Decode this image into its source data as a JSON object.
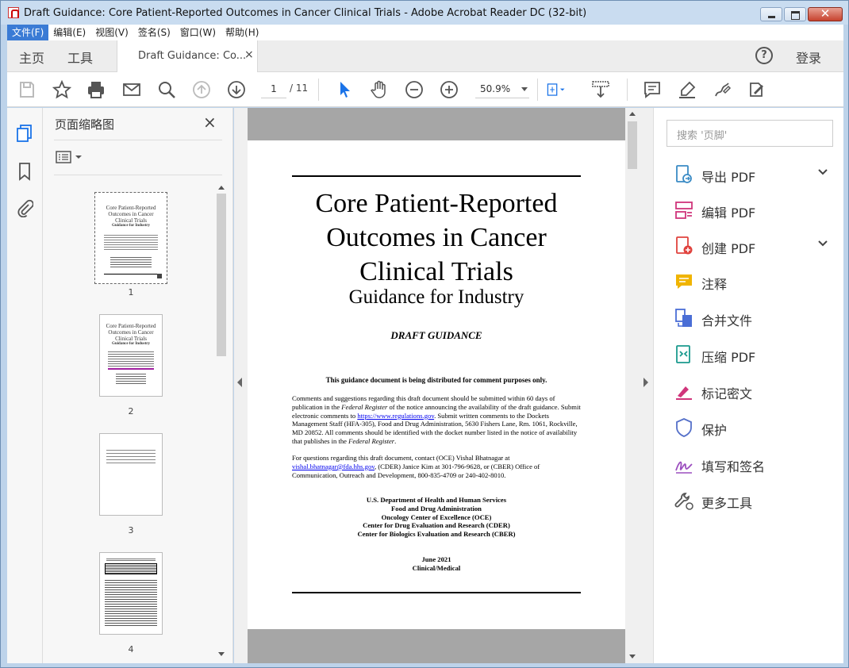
{
  "window": {
    "title": "Draft Guidance: Core Patient-Reported Outcomes in Cancer Clinical Trials - Adobe Acrobat Reader DC (32-bit)"
  },
  "menu": [
    "文件(F)",
    "编辑(E)",
    "视图(V)",
    "签名(S)",
    "窗口(W)",
    "帮助(H)"
  ],
  "tabs": {
    "home": "主页",
    "tools": "工具",
    "doc_tab": "Draft Guidance: Co...",
    "close": "×"
  },
  "account": {
    "login": "登录",
    "help": "?"
  },
  "toolbar": {
    "page_current": "1",
    "page_total": "/ 11",
    "zoom": "50.9%"
  },
  "thumbnail_panel": {
    "title": "页面缩略图",
    "close": "×",
    "pages": [
      "1",
      "2",
      "3",
      "4"
    ]
  },
  "right_panel": {
    "search_placeholder": "搜索 '页脚'",
    "tools": [
      {
        "label": "导出 PDF",
        "icon": "export-pdf-icon",
        "color": "#3a8bc5"
      },
      {
        "label": "编辑 PDF",
        "icon": "edit-pdf-icon",
        "color": "#d0357b"
      },
      {
        "label": "创建 PDF",
        "icon": "create-pdf-icon",
        "color": "#e0433e"
      },
      {
        "label": "注释",
        "icon": "comment-icon",
        "color": "#f0b400"
      },
      {
        "label": "合并文件",
        "icon": "combine-files-icon",
        "color": "#4a6ed6"
      },
      {
        "label": "压缩 PDF",
        "icon": "compress-pdf-icon",
        "color": "#1b9a8e"
      },
      {
        "label": "标记密文",
        "icon": "redact-icon",
        "color": "#d0357b"
      },
      {
        "label": "保护",
        "icon": "protect-icon",
        "color": "#5570c9"
      },
      {
        "label": "填写和签名",
        "icon": "fill-sign-icon",
        "color": "#9c4fbf"
      },
      {
        "label": "更多工具",
        "icon": "more-tools-icon",
        "color": "#555555"
      }
    ]
  },
  "document": {
    "title_lines": [
      "Core Patient-Reported",
      "Outcomes in Cancer",
      "Clinical Trials"
    ],
    "subtitle": "Guidance for Industry",
    "draft": "DRAFT GUIDANCE",
    "distribution": "This guidance document is being distributed for comment purposes only.",
    "para1_a": "Comments and suggestions regarding this draft document should be submitted within 60 days of publication in the ",
    "para1_fr1": "Federal Register",
    "para1_b": " of the notice announcing the availability of the draft guidance.  Submit electronic comments to ",
    "para1_link": "https://www.regulations.gov",
    "para1_c": ".  Submit written comments to the Dockets Management Staff (HFA-305), Food and Drug Administration, 5630 Fishers Lane, Rm. 1061, Rockville, MD  20852.  All comments should be identified with the docket number listed in the notice of availability that publishes in the ",
    "para1_fr2": "Federal Register",
    "para1_d": ".",
    "para2_a": "For questions regarding this draft document, contact (OCE) Vishal Bhatnagar at ",
    "para2_link": "vishal.bhatnagar@fda.hhs.gov",
    "para2_b": ", (CDER) Janice Kim at 301-796-9628, or (CBER) Office of Communication, Outreach and Development, 800-835-4709 or 240-402-8010.",
    "agency": [
      "U.S. Department of Health and Human Services",
      "Food and Drug Administration",
      "Oncology Center of Excellence (OCE)",
      "Center for Drug Evaluation and Research (CDER)",
      "Center for Biologics Evaluation and Research (CBER)"
    ],
    "date": "June 2021",
    "category": "Clinical/Medical"
  },
  "thumb_text": {
    "t1_title": "Core Patient-Reported Outcomes in Cancer Clinical Trials",
    "t1_sub": "Guidance for Industry"
  }
}
